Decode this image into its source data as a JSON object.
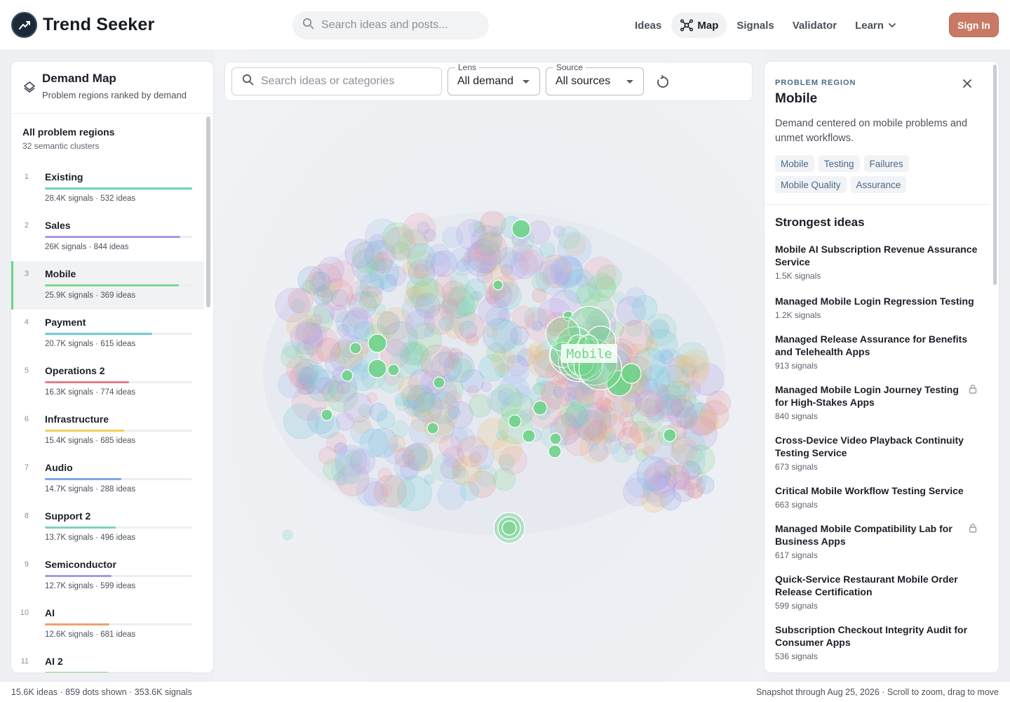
{
  "app": {
    "name": "Trend Seeker"
  },
  "header": {
    "search_placeholder": "Search ideas and posts...",
    "nav": [
      {
        "label": "Ideas",
        "icon": ""
      },
      {
        "label": "Map",
        "icon": "network-icon",
        "active": true
      },
      {
        "label": "Signals",
        "icon": ""
      },
      {
        "label": "Validator",
        "icon": ""
      },
      {
        "label": "Learn",
        "icon": "chevron-down-icon"
      }
    ],
    "sign_in": "Sign In"
  },
  "left_panel": {
    "title": "Demand Map",
    "subtitle": "Problem regions ranked by demand",
    "all_title": "All problem regions",
    "all_sub": "32 semantic clusters",
    "regions": [
      {
        "rank": "1",
        "name": "Existing",
        "meta": "28.4K signals · 532 ideas",
        "share": 1.0,
        "color": "#6fd3b6"
      },
      {
        "rank": "2",
        "name": "Sales",
        "meta": "26K signals · 844 ideas",
        "share": 0.92,
        "color": "#a99ae0"
      },
      {
        "rank": "3",
        "name": "Mobile",
        "meta": "25.9K signals · 369 ideas",
        "share": 0.91,
        "color": "#7ed88f",
        "selected": true
      },
      {
        "rank": "4",
        "name": "Payment",
        "meta": "20.7K signals · 615 ideas",
        "share": 0.73,
        "color": "#6fcdd8"
      },
      {
        "rank": "5",
        "name": "Operations 2",
        "meta": "16.3K signals · 774 ideas",
        "share": 0.57,
        "color": "#e07f8a"
      },
      {
        "rank": "6",
        "name": "Infrastructure",
        "meta": "15.4K signals · 685 ideas",
        "share": 0.54,
        "color": "#f0d060"
      },
      {
        "rank": "7",
        "name": "Audio",
        "meta": "14.7K signals · 288 ideas",
        "share": 0.52,
        "color": "#7fa8e6"
      },
      {
        "rank": "8",
        "name": "Support 2",
        "meta": "13.7K signals · 496 ideas",
        "share": 0.48,
        "color": "#7fd3b8"
      },
      {
        "rank": "9",
        "name": "Semiconductor",
        "meta": "12.7K signals · 599 ideas",
        "share": 0.45,
        "color": "#a79ae0"
      },
      {
        "rank": "10",
        "name": "AI",
        "meta": "12.6K signals · 681 ideas",
        "share": 0.44,
        "color": "#f0a070"
      },
      {
        "rank": "11",
        "name": "AI 2",
        "meta": "",
        "share": 0.43,
        "color": "#7fd88f"
      }
    ]
  },
  "map": {
    "search_placeholder": "Search ideas or categories",
    "lens_label": "Lens",
    "lens_value": "All demand",
    "source_label": "Source",
    "source_value": "All sources",
    "selected_label": "Mobile"
  },
  "right_panel": {
    "eyebrow": "PROBLEM REGION",
    "title": "Mobile",
    "description": "Demand centered on mobile problems and unmet workflows.",
    "tags": [
      "Mobile",
      "Testing",
      "Failures",
      "Mobile Quality",
      "Assurance"
    ],
    "strongest_title": "Strongest ideas",
    "ideas": [
      {
        "title": "Mobile AI Subscription Revenue Assurance Service",
        "signals": "1.5K signals",
        "locked": false
      },
      {
        "title": "Managed Mobile Login Regression Testing",
        "signals": "1.2K signals",
        "locked": false
      },
      {
        "title": "Managed Release Assurance for Benefits and Telehealth Apps",
        "signals": "913 signals",
        "locked": false
      },
      {
        "title": "Managed Mobile Login Journey Testing for High-Stakes Apps",
        "signals": "840 signals",
        "locked": true
      },
      {
        "title": "Cross-Device Video Playback Continuity Testing Service",
        "signals": "673 signals",
        "locked": false
      },
      {
        "title": "Critical Mobile Workflow Testing Service",
        "signals": "663 signals",
        "locked": false
      },
      {
        "title": "Managed Mobile Compatibility Lab for Business Apps",
        "signals": "617 signals",
        "locked": true
      },
      {
        "title": "Quick-Service Restaurant Mobile Order Release Certification",
        "signals": "599 signals",
        "locked": false
      },
      {
        "title": "Subscription Checkout Integrity Audit for Consumer Apps",
        "signals": "536 signals",
        "locked": false
      }
    ]
  },
  "footer": {
    "left": "15.6K ideas · 859 dots shown · 353.6K signals",
    "right": "Snapshot through Aug 25, 2026 · Scroll to zoom, drag to move"
  },
  "colors": {
    "accent": "#6fd38a",
    "sign_in": "#c97a64",
    "tag_text": "#4e6a86"
  }
}
